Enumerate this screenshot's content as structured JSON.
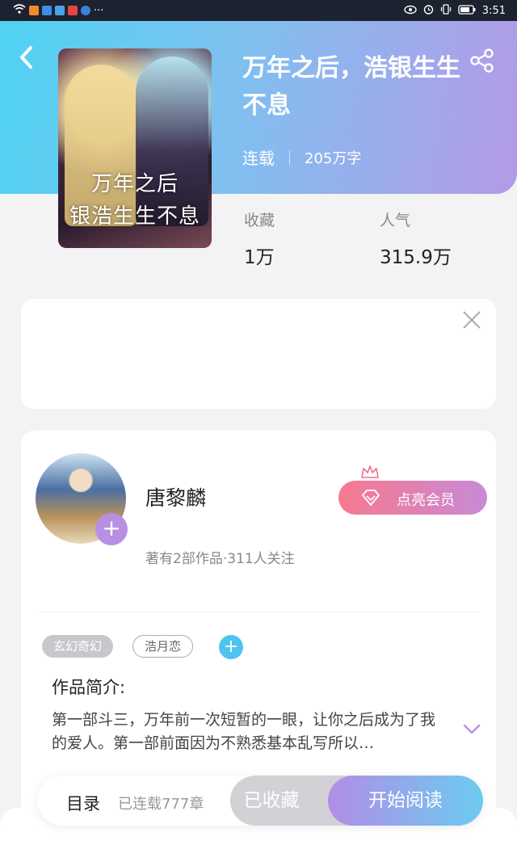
{
  "status_bar": {
    "time": "3:51",
    "dots": "···"
  },
  "header": {
    "back_icon": "chevron-left-icon",
    "share_icon": "share-icon"
  },
  "book": {
    "cover_text_line1": "万年之后",
    "cover_text_line2": "银浩生生不息",
    "title": "万年之后，浩银生生不息",
    "status": "连载",
    "word_count": "205万字",
    "stats": [
      {
        "label": "收藏",
        "value": "1万"
      },
      {
        "label": "人气",
        "value": "315.9万"
      }
    ]
  },
  "author": {
    "name": "唐黎麟",
    "meta": "著有2部作品·311人关注",
    "follow_symbol": "+",
    "vip_label": "点亮会员"
  },
  "tags": [
    {
      "label": "玄幻奇幻"
    },
    {
      "label": "浩月恋"
    }
  ],
  "tag_add_symbol": "+",
  "intro": {
    "title": "作品简介:",
    "text": "第一部斗三，万年前一次短暂的一眼，让你之后成为了我的爱人。第一部前面因为不熟悉基本乱写所以…"
  },
  "bottom_bar": {
    "toc_label": "目录",
    "toc_count": "已连载777章",
    "favorite_label": "已收藏",
    "read_label": "开始阅读"
  },
  "colors": {
    "header_gradient_start": "#4fd3f3",
    "header_gradient_end": "#b49ae8",
    "read_button_start": "#b18de6",
    "read_button_end": "#6ccbf1",
    "vip_start": "#f7798e",
    "vip_end": "#c88ad6"
  }
}
